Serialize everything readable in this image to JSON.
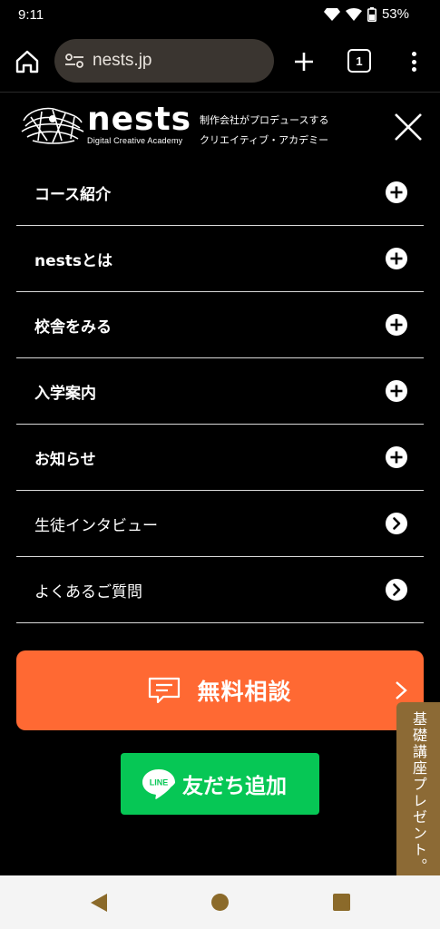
{
  "status_bar": {
    "time": "9:11",
    "battery": "53%",
    "icons": [
      "diamond-notification-icon",
      "wifi-icon",
      "battery-icon"
    ]
  },
  "browser": {
    "url": "nests.jp",
    "tab_count": "1",
    "icons": [
      "home-icon",
      "site-settings-icon",
      "new-tab-icon",
      "more-icon"
    ]
  },
  "header": {
    "logo_name": "nests",
    "logo_subtitle": "Digital Creative Academy",
    "tagline_line1": "制作会社がプロデュースする",
    "tagline_line2": "クリエイティブ・アカデミー"
  },
  "menu": {
    "items": [
      {
        "label": "コース紹介",
        "icon": "plus-circle-icon"
      },
      {
        "label": "nestsとは",
        "icon": "plus-circle-icon"
      },
      {
        "label": "校舎をみる",
        "icon": "plus-circle-icon"
      },
      {
        "label": "入学案内",
        "icon": "plus-circle-icon"
      },
      {
        "label": "お知らせ",
        "icon": "plus-circle-icon"
      },
      {
        "label": "生徒インタビュー",
        "icon": "arrow-circle-icon"
      },
      {
        "label": "よくあるご質問",
        "icon": "arrow-circle-icon"
      }
    ]
  },
  "cta": {
    "consult_label": "無料相談",
    "line_logo_text": "LINE",
    "line_label": "友だち追加"
  },
  "side_tab": {
    "label": "基礎講座プレゼント。"
  },
  "colors": {
    "accent_orange": "#ff6933",
    "line_green": "#06c755",
    "side_tab_brown": "#8c6a35",
    "url_bar": "#3a3530"
  }
}
